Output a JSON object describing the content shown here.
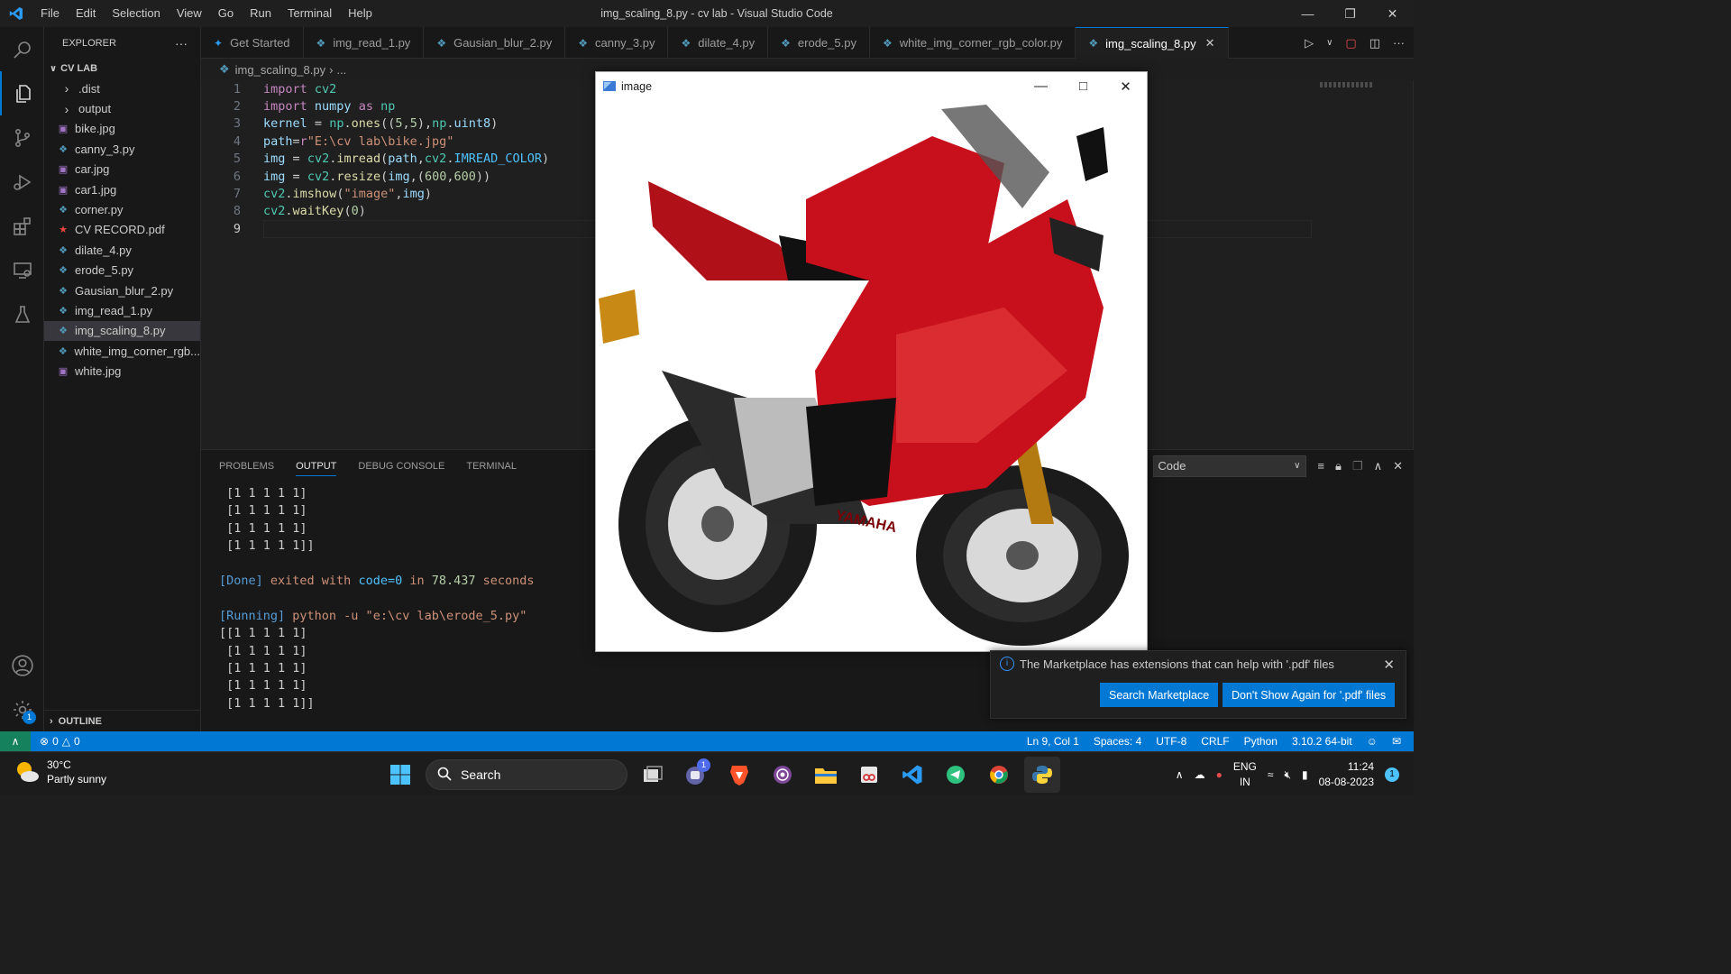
{
  "app": {
    "window_title": "img_scaling_8.py - cv lab - Visual Studio Code",
    "menu": [
      "File",
      "Edit",
      "Selection",
      "View",
      "Go",
      "Run",
      "Terminal",
      "Help"
    ]
  },
  "explorer": {
    "header": "EXPLORER",
    "folder": "CV LAB",
    "items": [
      {
        "label": ".dist",
        "type": "folder"
      },
      {
        "label": "output",
        "type": "folder"
      },
      {
        "label": "bike.jpg",
        "type": "image"
      },
      {
        "label": "canny_3.py",
        "type": "python"
      },
      {
        "label": "car.jpg",
        "type": "image"
      },
      {
        "label": "car1.jpg",
        "type": "image"
      },
      {
        "label": "corner.py",
        "type": "python"
      },
      {
        "label": "CV RECORD.pdf",
        "type": "pdf"
      },
      {
        "label": "dilate_4.py",
        "type": "python"
      },
      {
        "label": "erode_5.py",
        "type": "python"
      },
      {
        "label": "Gausian_blur_2.py",
        "type": "python"
      },
      {
        "label": "img_read_1.py",
        "type": "python"
      },
      {
        "label": "img_scaling_8.py",
        "type": "python"
      },
      {
        "label": "white_img_corner_rgb...",
        "type": "python"
      },
      {
        "label": "white.jpg",
        "type": "image"
      }
    ],
    "outline_label": "OUTLINE"
  },
  "tabs": [
    {
      "label": "Get Started",
      "type": "vscode"
    },
    {
      "label": "img_read_1.py",
      "type": "python"
    },
    {
      "label": "Gausian_blur_2.py",
      "type": "python"
    },
    {
      "label": "canny_3.py",
      "type": "python"
    },
    {
      "label": "dilate_4.py",
      "type": "python"
    },
    {
      "label": "erode_5.py",
      "type": "python"
    },
    {
      "label": "white_img_corner_rgb_color.py",
      "type": "python"
    },
    {
      "label": "img_scaling_8.py",
      "type": "python"
    }
  ],
  "breadcrumb": {
    "file": "img_scaling_8.py",
    "rest": "..."
  },
  "editor": {
    "line_numbers": [
      "1",
      "2",
      "3",
      "4",
      "5",
      "6",
      "7",
      "8",
      "9"
    ],
    "lines": [
      "import cv2",
      "import numpy as np",
      "kernel = np.ones((5,5),np.uint8)",
      "path=r\"E:\\cv lab\\bike.jpg\"",
      "img = cv2.imread(path,cv2.IMREAD_COLOR)",
      "img = cv2.resize(img,(600,600))",
      "cv2.imshow(\"image\",img)",
      "cv2.waitKey(0)",
      ""
    ]
  },
  "panel": {
    "tabs": [
      "PROBLEMS",
      "OUTPUT",
      "DEBUG CONSOLE",
      "TERMINAL"
    ],
    "active_tab": "OUTPUT",
    "output_source": "Code",
    "output_lines": [
      " [1 1 1 1 1]",
      " [1 1 1 1 1]",
      " [1 1 1 1 1]",
      " [1 1 1 1 1]]",
      "",
      "[Done] exited with code=0 in 78.437 seconds",
      "",
      "[Running] python -u \"e:\\cv lab\\erode_5.py\"",
      "[[1 1 1 1 1]",
      " [1 1 1 1 1]",
      " [1 1 1 1 1]",
      " [1 1 1 1 1]",
      " [1 1 1 1 1]]"
    ]
  },
  "image_window": {
    "title": "image",
    "watermark": "YAMAHA"
  },
  "notification": {
    "message": "The Marketplace has extensions that can help with '.pdf' files",
    "primary_button": "Search Marketplace",
    "secondary_button": "Don't Show Again for '.pdf' files"
  },
  "statusbar": {
    "errors": "0",
    "warnings": "0",
    "position": "Ln 9, Col 1",
    "spaces": "Spaces: 4",
    "encoding": "UTF-8",
    "eol": "CRLF",
    "language": "Python",
    "interpreter": "3.10.2 64-bit"
  },
  "taskbar": {
    "temperature": "30°C",
    "weather": "Partly sunny",
    "search_label": "Search",
    "lang_line1": "ENG",
    "lang_line2": "IN",
    "time": "11:24",
    "date": "08-08-2023",
    "notification_count": "1",
    "teams_badge": "1"
  },
  "colors": {
    "accent": "#0078d4",
    "python_icon": "#519aba",
    "bike_red": "#c8101c"
  }
}
